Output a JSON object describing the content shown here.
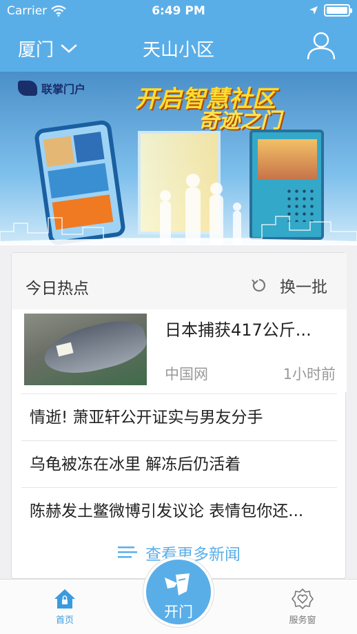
{
  "status_bar": {
    "carrier": "Carrier",
    "time": "6:49 PM"
  },
  "nav": {
    "city": "厦门",
    "title": "天山小区"
  },
  "banner": {
    "brand": "联掌门户",
    "slogan_line1": "开启智慧社区",
    "slogan_line2": "奇迹之门"
  },
  "news": {
    "section_title": "今日热点",
    "refresh_label": "换一批",
    "featured": {
      "title": "日本捕获417公斤...",
      "source": "中国网",
      "time": "1小时前"
    },
    "items": [
      "情逝! 萧亚轩公开证实与男友分手",
      "乌龟被冻在冰里 解冻后仍活着",
      "陈赫发土鳖微博引发议论 表情包你还..."
    ],
    "more_label": "查看更多新闻"
  },
  "tabbar": {
    "home": "首页",
    "open": "开门",
    "service": "服务窗"
  },
  "colors": {
    "primary": "#5aaee8",
    "tab_active": "#3a9be0"
  }
}
